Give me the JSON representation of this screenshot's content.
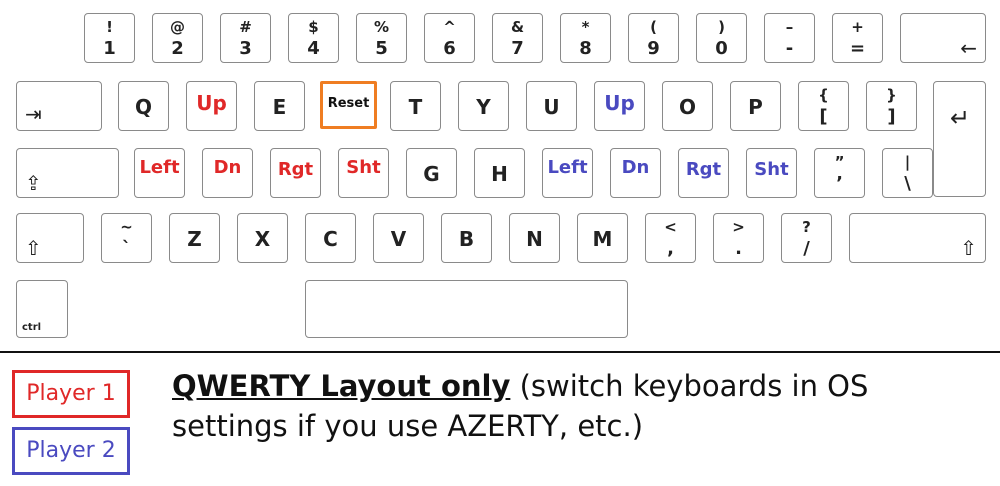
{
  "keys": {
    "num": [
      {
        "top": "!",
        "bot": "1"
      },
      {
        "top": "@",
        "bot": "2"
      },
      {
        "top": "#",
        "bot": "3"
      },
      {
        "top": "$",
        "bot": "4"
      },
      {
        "top": "%",
        "bot": "5"
      },
      {
        "top": "^",
        "bot": "6"
      },
      {
        "top": "&",
        "bot": "7"
      },
      {
        "top": "*",
        "bot": "8"
      },
      {
        "top": "(",
        "bot": "9"
      },
      {
        "top": ")",
        "bot": "0"
      },
      {
        "top": "–",
        "bot": "-"
      },
      {
        "top": "+",
        "bot": "="
      }
    ],
    "row_q": [
      {
        "label": "Q",
        "player": ""
      },
      {
        "label": "Up",
        "player": "1"
      },
      {
        "label": "E",
        "player": ""
      },
      {
        "label": "Reset",
        "player": "reset"
      },
      {
        "label": "T",
        "player": ""
      },
      {
        "label": "Y",
        "player": ""
      },
      {
        "label": "U",
        "player": ""
      },
      {
        "label": "Up",
        "player": "2"
      },
      {
        "label": "O",
        "player": ""
      },
      {
        "label": "P",
        "player": ""
      }
    ],
    "brackets": [
      {
        "top": "{",
        "bot": "["
      },
      {
        "top": "}",
        "bot": "]"
      }
    ],
    "row_a": [
      {
        "label": "Left",
        "player": "1"
      },
      {
        "label": "Dn",
        "player": "1"
      },
      {
        "label": "Rgt",
        "player": "1"
      },
      {
        "label": "Sht",
        "player": "1"
      },
      {
        "label": "G",
        "player": ""
      },
      {
        "label": "H",
        "player": ""
      },
      {
        "label": "Left",
        "player": "2"
      },
      {
        "label": "Dn",
        "player": "2"
      },
      {
        "label": "Rgt",
        "player": "2"
      },
      {
        "label": "Sht",
        "player": "2"
      }
    ],
    "quote": {
      "top": "”",
      "bot": "’"
    },
    "pipe": {
      "top": "|",
      "bot": "\\"
    },
    "tilde": {
      "top": "~",
      "bot": "`"
    },
    "row_z": [
      {
        "label": "Z"
      },
      {
        "label": "X"
      },
      {
        "label": "C"
      },
      {
        "label": "V"
      },
      {
        "label": "B"
      },
      {
        "label": "N"
      },
      {
        "label": "M"
      }
    ],
    "punct": [
      {
        "top": "<",
        "bot": ","
      },
      {
        "top": ">",
        "bot": "."
      },
      {
        "top": "?",
        "bot": "/"
      }
    ],
    "ctrl": "ctrl",
    "icons": {
      "backspace": "←",
      "tab": "⇥",
      "enter": "↵",
      "capslock": "⇪",
      "shift": "⇧"
    }
  },
  "legend": {
    "p1": "Player 1",
    "p2": "Player 2",
    "colors": {
      "p1": "#e02828",
      "p2": "#4a4ac0",
      "reset": "#ef7d22"
    }
  },
  "note": {
    "strong": "QWERTY Layout only",
    "rest": " (switch keyboards in OS settings if you use AZERTY, etc.)"
  }
}
